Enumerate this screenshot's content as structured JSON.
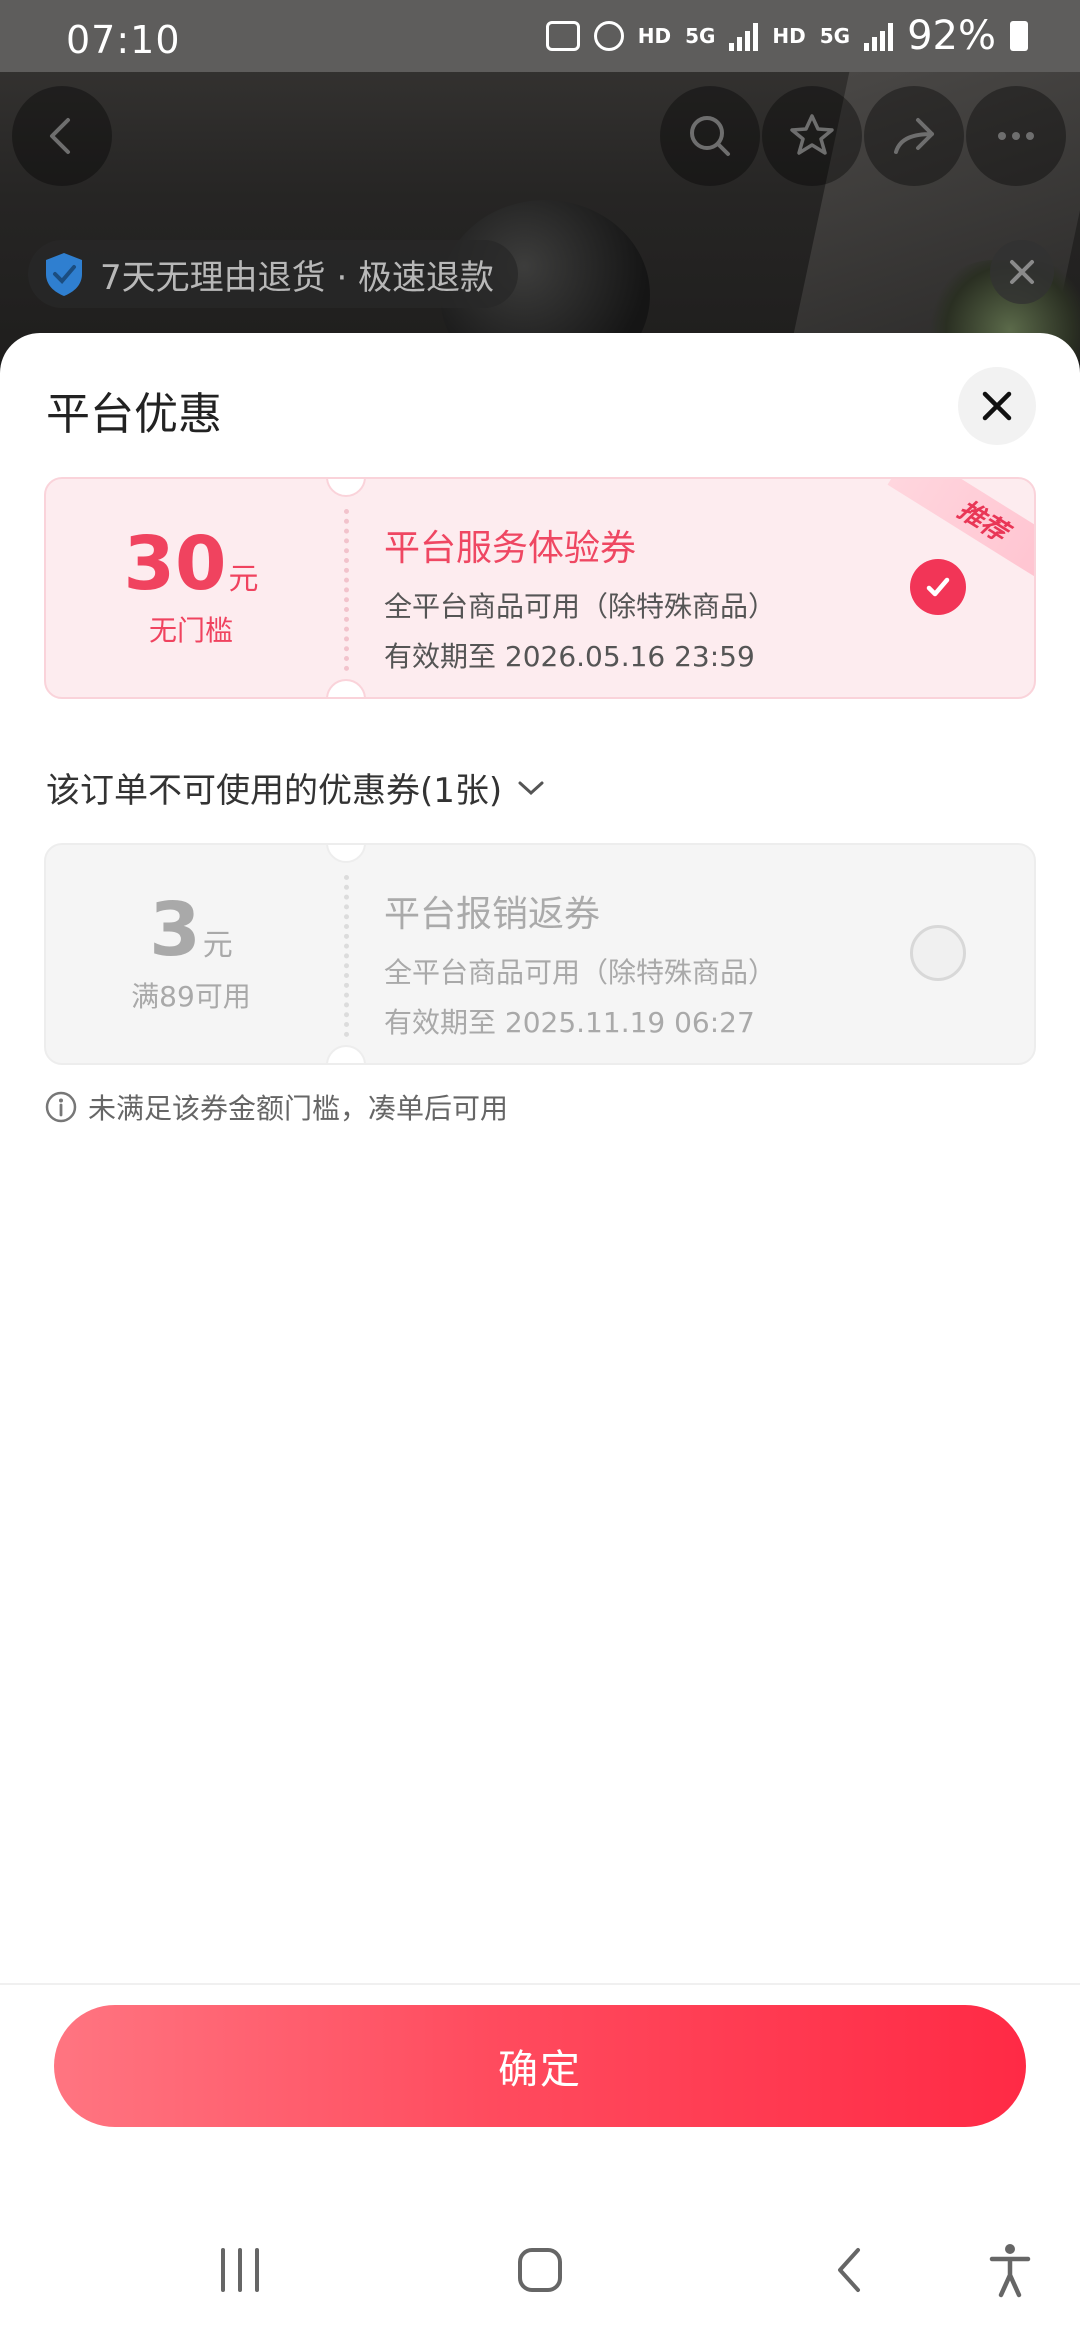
{
  "status_bar": {
    "time": "07:10",
    "network_1": "HD",
    "network_1_type": "5G",
    "network_2": "HD",
    "network_2_type": "5G",
    "battery": "92%",
    "icons": [
      "chat-sync-icon",
      "alarm-icon",
      "signal-icon",
      "signal-icon",
      "battery-icon"
    ]
  },
  "background_page": {
    "guarantee": "7天无理由退货 · 极速退款",
    "nav_icons": [
      "back-icon",
      "search-icon",
      "star-icon",
      "share-icon",
      "more-icon"
    ]
  },
  "sheet": {
    "title": "平台优惠",
    "close_icon": "close-icon",
    "recommended_badge": "推荐",
    "usable_coupons": [
      {
        "amount": "30",
        "unit": "元",
        "condition": "无门槛",
        "name": "平台服务体验券",
        "desc": "全平台商品可用（除特殊商品）",
        "expiry": "有效期至 2026.05.16 23:59",
        "selected": true
      }
    ],
    "unusable_section_title": "该订单不可使用的优惠券(1张)",
    "unusable_coupons": [
      {
        "amount": "3",
        "unit": "元",
        "condition": "满89可用",
        "name": "平台报销返券",
        "desc": "全平台商品可用（除特殊商品）",
        "expiry": "有效期至 2025.11.19 06:27",
        "selected": false
      }
    ],
    "unusable_tip": "未满足该券金额门槛，凑单后可用",
    "confirm_label": "确定"
  },
  "system_nav": [
    "recents-icon",
    "home-icon",
    "back-icon",
    "accessibility-icon"
  ],
  "colors": {
    "accent": "#f23557",
    "coupon_bg": "#fdecef",
    "disabled_bg": "#f5f5f5"
  }
}
